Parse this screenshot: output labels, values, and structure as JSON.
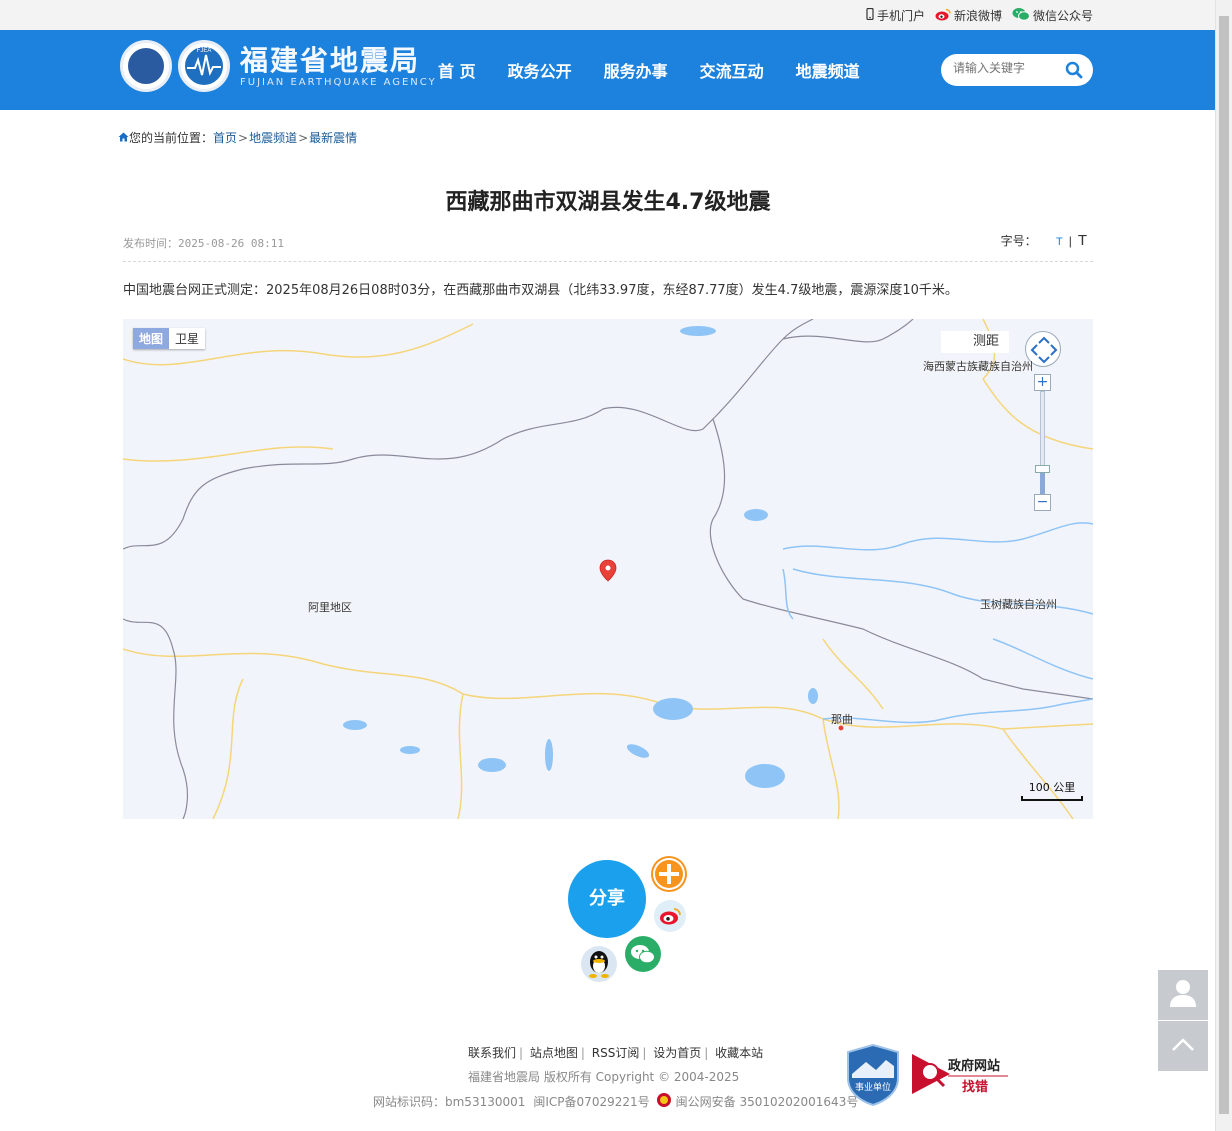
{
  "topbar": {
    "mobile": "手机门户",
    "weibo": "新浪微博",
    "wechat": "微信公众号"
  },
  "header": {
    "logo_cn": "福建省地震局",
    "logo_en": "FUJIAN EARTHQUAKE AGENCY",
    "logo_badge": "FJEA",
    "nav": [
      "首 页",
      "政务公开",
      "服务办事",
      "交流互动",
      "地震频道"
    ],
    "search_placeholder": "请输入关键字"
  },
  "breadcrumb": {
    "prefix": "您的当前位置：",
    "items": [
      "首页",
      "地震频道",
      "最新震情"
    ],
    "separator": ">"
  },
  "article": {
    "title": "西藏那曲市双湖县发生4.7级地震",
    "published": "发布时间：2025-08-26 08:11",
    "font_size_label": "字号：",
    "font_small": "T",
    "font_large": "T",
    "body": "中国地震台网正式测定：2025年08月26日08时03分，在西藏那曲市双湖县（北纬33.97度，东经87.77度）发生4.7级地震，震源深度10千米。"
  },
  "map": {
    "type_map": "地图",
    "type_satellite": "卫星",
    "measure": "测距",
    "labels": {
      "haixi": "海西蒙古族藏族自治州",
      "yushu": "玉树藏族自治州",
      "ali": "阿里地区",
      "naqu": "那曲"
    },
    "scale": "100 公里",
    "colors": {
      "land": "#f2f4fb",
      "water": "#8ec4f6",
      "border": "#8a8a9a",
      "province": "#f5d57a",
      "marker": "#e8413a"
    }
  },
  "share": {
    "label": "分享",
    "icons": [
      "plus-icon",
      "weibo-icon",
      "wechat-icon",
      "qq-icon"
    ]
  },
  "footer": {
    "links": [
      "联系我们",
      "站点地图",
      "RSS订阅",
      "设为首页",
      "收藏本站"
    ],
    "copyright": "福建省地震局   版权所有    Copyright © 2004-2025",
    "site_id": "网站标识码：bm53130001",
    "icp": "闽ICP备07029221号",
    "police": "闽公网安备 35010202001643号",
    "badge_text": "事业单位",
    "jiucuo_title": "政府网站",
    "jiucuo_sub": "找错"
  }
}
